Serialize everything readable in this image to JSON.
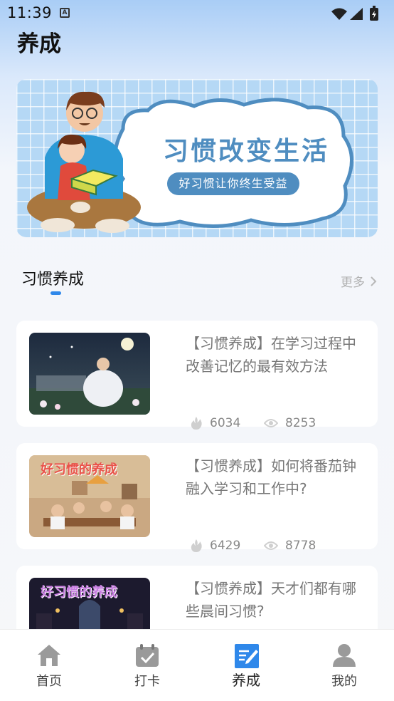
{
  "status_bar": {
    "time": "11:39",
    "notification_icon": "A"
  },
  "page": {
    "title": "养成"
  },
  "banner": {
    "headline": "习惯改变生活",
    "subline": "好习惯让你终生受益"
  },
  "section": {
    "title": "习惯养成",
    "more_label": "更多"
  },
  "articles": [
    {
      "title": "【习惯养成】在学习过程中改善记忆的最有效方法",
      "likes": "6034",
      "views": "8253",
      "thumb_text": ""
    },
    {
      "title": "【习惯养成】如何将番茄钟融入学习和工作中?",
      "likes": "6429",
      "views": "8778",
      "thumb_text": "好习惯的养成"
    },
    {
      "title": "【习惯养成】天才们都有哪些晨间习惯?",
      "likes": "",
      "views": "",
      "thumb_text": "好习惯的养成"
    }
  ],
  "tabbar": [
    {
      "label": "首页",
      "icon": "home-icon",
      "active": false
    },
    {
      "label": "打卡",
      "icon": "calendar-check-icon",
      "active": false
    },
    {
      "label": "养成",
      "icon": "notebook-icon",
      "active": true
    },
    {
      "label": "我的",
      "icon": "user-icon",
      "active": false
    }
  ],
  "colors": {
    "accent": "#2f88ea",
    "banner_blue": "#4f8dc0"
  }
}
